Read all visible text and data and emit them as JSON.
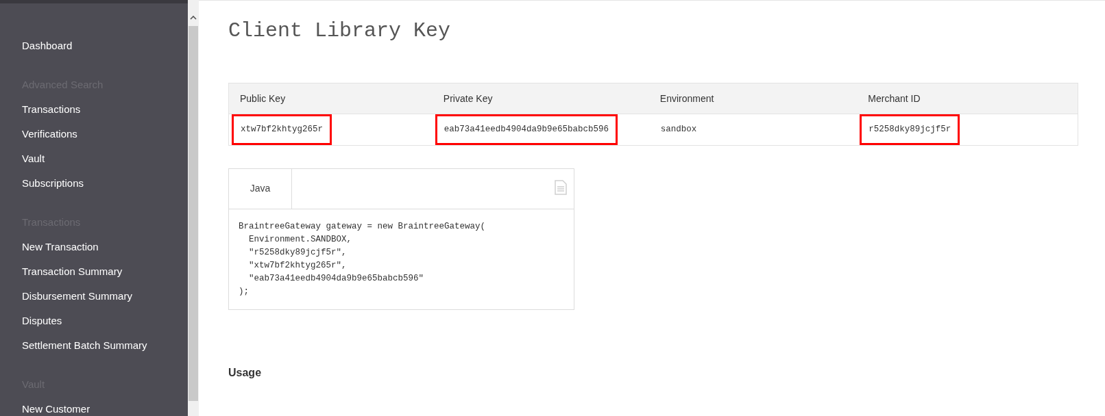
{
  "sidebar": {
    "sections": [
      {
        "items": [
          {
            "label": "Dashboard"
          }
        ]
      },
      {
        "heading": "Advanced Search",
        "items": [
          {
            "label": "Transactions"
          },
          {
            "label": "Verifications"
          },
          {
            "label": "Vault"
          },
          {
            "label": "Subscriptions"
          }
        ]
      },
      {
        "heading": "Transactions",
        "items": [
          {
            "label": "New Transaction"
          },
          {
            "label": "Transaction Summary"
          },
          {
            "label": "Disbursement Summary"
          },
          {
            "label": "Disputes"
          },
          {
            "label": "Settlement Batch Summary"
          }
        ]
      },
      {
        "heading": "Vault",
        "items": [
          {
            "label": "New Customer"
          }
        ]
      }
    ]
  },
  "title": "Client Library Key",
  "table": {
    "columns": [
      "Public Key",
      "Private Key",
      "Environment",
      "Merchant ID"
    ],
    "row": [
      {
        "value": "xtw7bf2khtyg265r",
        "highlighted": true
      },
      {
        "value": "eab73a41eedb4904da9b9e65babcb596",
        "highlighted": true
      },
      {
        "value": "sandbox",
        "highlighted": false
      },
      {
        "value": "r5258dky89jcjf5r",
        "highlighted": true
      }
    ]
  },
  "code_panel": {
    "tabs": [
      {
        "label": "Java",
        "selected": true
      }
    ],
    "lines": [
      "BraintreeGateway gateway = new BraintreeGateway(",
      "  Environment.SANDBOX,",
      "  \"r5258dky89jcjf5r\",",
      "  \"xtw7bf2khtyg265r\",",
      "  \"eab73a41eedb4904da9b9e65babcb596\"",
      ");"
    ]
  },
  "usage_heading": "Usage"
}
